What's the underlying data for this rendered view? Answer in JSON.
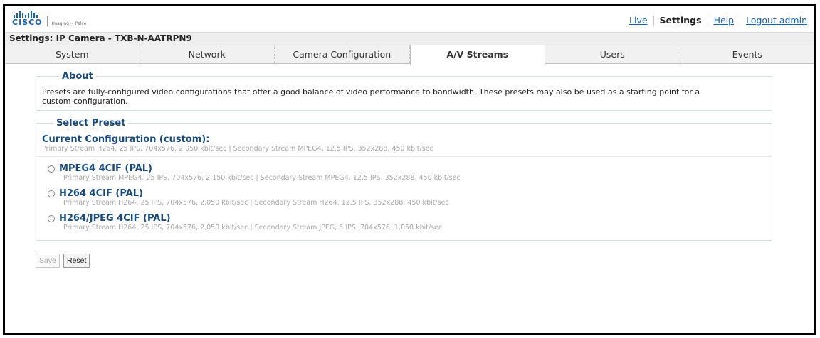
{
  "brand": {
    "logo_text": "CISCO",
    "sublogo": "Imaging ~ Pelco"
  },
  "topnav": {
    "live": "Live",
    "settings": "Settings",
    "help": "Help",
    "logout": "Logout admin"
  },
  "page_title": "Settings: IP Camera - TXB-N-AATRPN9",
  "tabs": [
    {
      "label": "System"
    },
    {
      "label": "Network"
    },
    {
      "label": "Camera Configuration"
    },
    {
      "label": "A/V Streams",
      "active": true
    },
    {
      "label": "Users"
    },
    {
      "label": "Events"
    }
  ],
  "about": {
    "legend": "About",
    "text": "Presets are fully-configured video configurations that offer a good balance of video performance to bandwidth. These presets may also be used as a starting point for a custom configuration."
  },
  "select_preset": {
    "legend": "Select Preset",
    "current_title": "Current Configuration (custom):",
    "current_desc": "Primary Stream H264, 25 IPS, 704x576, 2,050 kbit/sec | Secondary Stream MPEG4, 12.5 IPS, 352x288, 450 kbit/sec",
    "options": [
      {
        "title": "MPEG4 4CIF (PAL)",
        "desc": "Primary Stream MPEG4, 25 IPS, 704x576, 2,150 kbit/sec | Secondary Stream MPEG4, 12.5 IPS, 352x288, 450 kbit/sec"
      },
      {
        "title": "H264 4CIF (PAL)",
        "desc": "Primary Stream H264, 25 IPS, 704x576, 2,050 kbit/sec | Secondary Stream H264, 12.5 IPS, 352x288, 450 kbit/sec"
      },
      {
        "title": "H264/JPEG 4CIF (PAL)",
        "desc": "Primary Stream H264, 25 IPS, 704x576, 2,050 kbit/sec | Secondary Stream JPEG, 5 IPS, 704x576, 1,050 kbit/sec"
      }
    ]
  },
  "buttons": {
    "save": "Save",
    "reset": "Reset"
  },
  "colors": {
    "brand_blue": "#1a5fa8",
    "heading_blue": "#1a4a7a",
    "muted_text": "#a8a8a8"
  }
}
